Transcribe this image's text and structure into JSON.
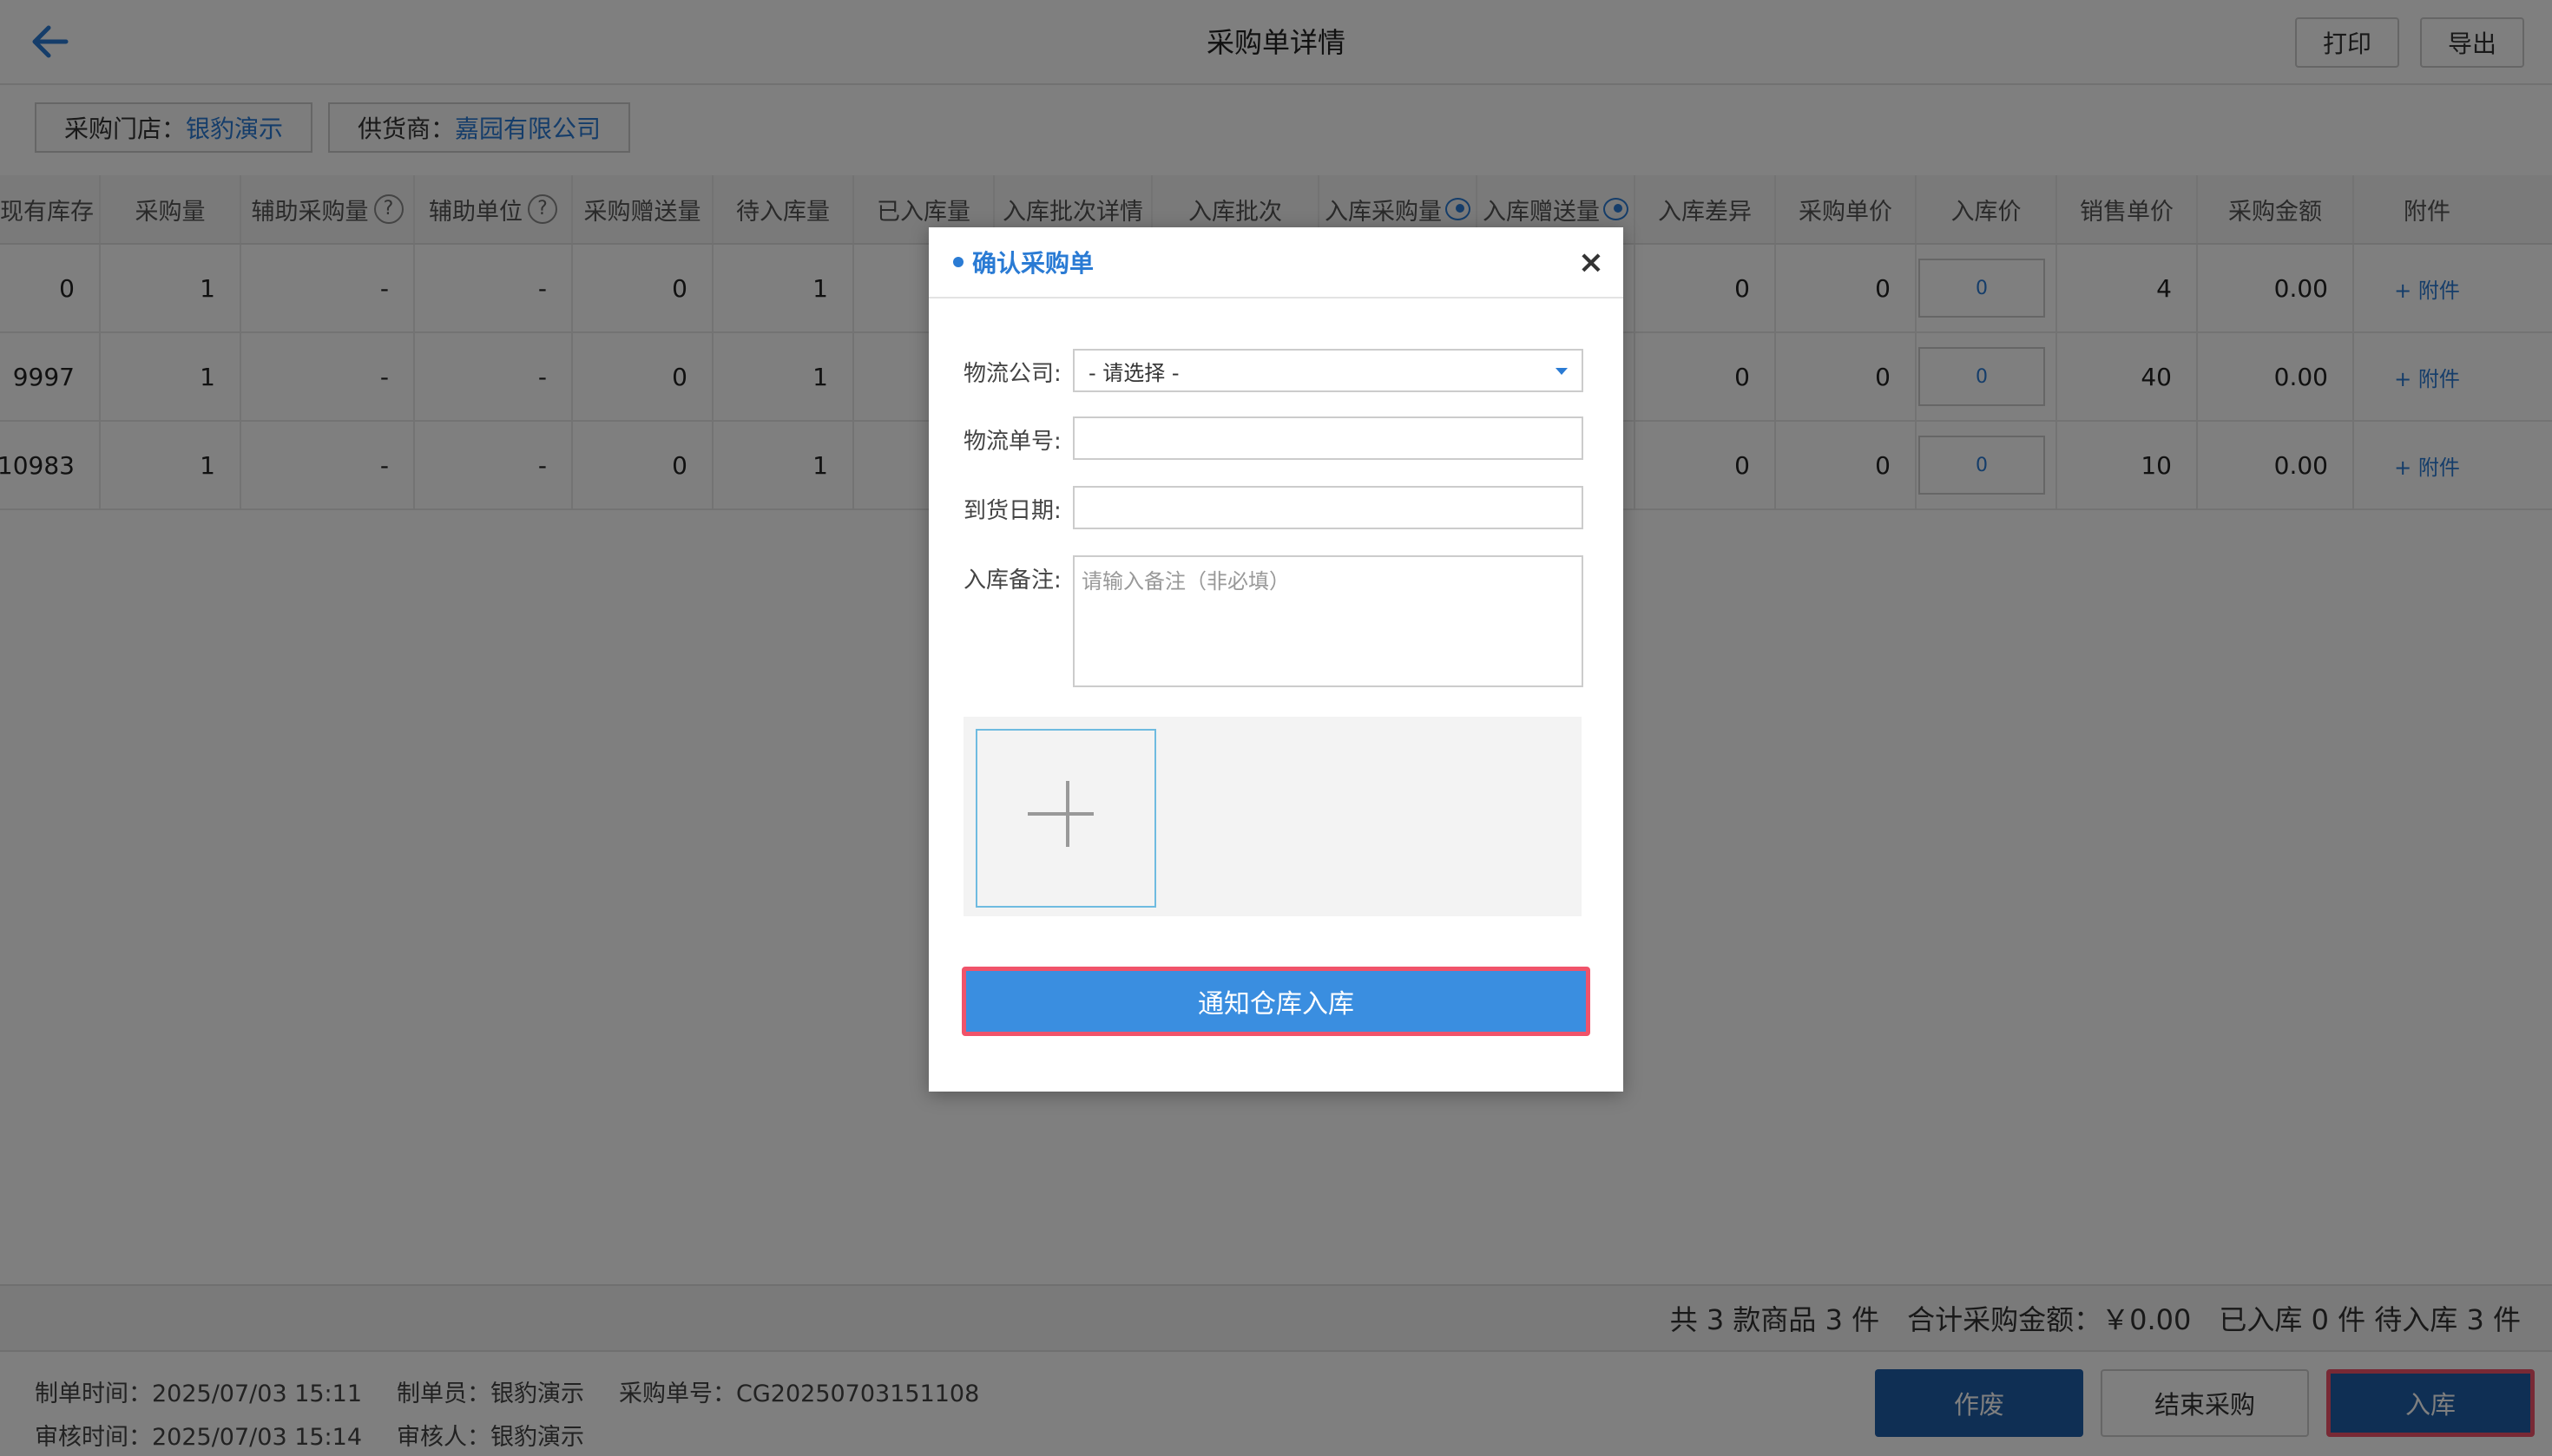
{
  "header": {
    "title": "采购单详情",
    "print_label": "打印",
    "export_label": "导出"
  },
  "tags": [
    {
      "label": "采购门店：",
      "value": "银豹演示"
    },
    {
      "label": "供货商：",
      "value": "嘉园有限公司"
    }
  ],
  "table": {
    "columns": [
      "现有库存",
      "采购量",
      "辅助采购量",
      "辅助单位",
      "采购赠送量",
      "待入库量",
      "已入库量",
      "入库批次详情",
      "入库批次",
      "入库采购量",
      "入库赠送量",
      "入库差异",
      "采购单价",
      "入库价",
      "销售单价",
      "采购金额",
      "附件"
    ],
    "rows": [
      {
        "stock": "0",
        "qty": "1",
        "aux_qty": "-",
        "aux_unit": "-",
        "gift": "0",
        "pending": "1",
        "diff": "0",
        "unit_price": "0",
        "in_price": "0",
        "sale_price": "4",
        "amount": "0.00",
        "attach": "+ 附件"
      },
      {
        "stock": "9997",
        "qty": "1",
        "aux_qty": "-",
        "aux_unit": "-",
        "gift": "0",
        "pending": "1",
        "diff": "0",
        "unit_price": "0",
        "in_price": "0",
        "sale_price": "40",
        "amount": "0.00",
        "attach": "+ 附件"
      },
      {
        "stock": "10983",
        "qty": "1",
        "aux_qty": "-",
        "aux_unit": "-",
        "gift": "0",
        "pending": "1",
        "diff": "0",
        "unit_price": "0",
        "in_price": "0",
        "sale_price": "10",
        "amount": "0.00",
        "attach": "+ 附件"
      }
    ]
  },
  "summary": {
    "count": "共 3 款商品 3 件",
    "total": "合计采购金额：￥0.00",
    "status": "已入库 0 件 待入库 3 件"
  },
  "footer": {
    "created_time": "制单时间：2025/07/03 15:11",
    "creator": "制单员：银豹演示",
    "order_no": "采购单号：CG20250703151108",
    "audit_time": "审核时间：2025/07/03 15:14",
    "auditor": "审核人：银豹演示",
    "void_label": "作废",
    "finish_label": "结束采购",
    "stockin_label": "入库"
  },
  "modal": {
    "title": "确认采购单",
    "logistics_company_label": "物流公司:",
    "logistics_company_value": "- 请选择 -",
    "logistics_no_label": "物流单号:",
    "arrival_date_label": "到货日期:",
    "remark_label": "入库备注:",
    "remark_placeholder": "请输入备注（非必填）",
    "notify_label": "通知仓库入库"
  },
  "colors": {
    "accent": "#2a7bd4",
    "primary_button": "#3a8ee0",
    "dark_button": "#1f5ea8",
    "highlight": "#f0536a"
  }
}
